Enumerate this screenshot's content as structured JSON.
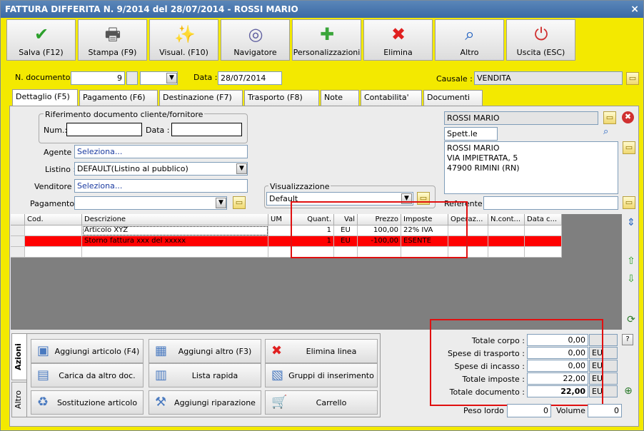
{
  "window": {
    "title": "FATTURA DIFFERITA N. 9/2014 del 28/07/2014 - ROSSI MARIO",
    "close": "×"
  },
  "toolbar": [
    {
      "label": "Salva (F12)",
      "icon": "check-icon",
      "glyph": "✔",
      "color": "#2ca02c"
    },
    {
      "label": "Stampa (F9)",
      "icon": "printer-icon",
      "glyph": "🖶",
      "color": "#555"
    },
    {
      "label": "Visual. (F10)",
      "icon": "magic-wand-icon",
      "glyph": "✨",
      "color": "#333"
    },
    {
      "label": "Navigatore",
      "icon": "compass-icon",
      "glyph": "◎",
      "color": "#6060a0"
    },
    {
      "label": "Personalizzazioni",
      "icon": "puzzle-icon",
      "glyph": "✚",
      "color": "#3aa53a"
    },
    {
      "label": "Elimina",
      "icon": "delete-x-icon",
      "glyph": "✖",
      "color": "#e02020"
    },
    {
      "label": "Altro",
      "icon": "magnifier-icon",
      "glyph": "⌕",
      "color": "#2060c0"
    },
    {
      "label": "Uscita (ESC)",
      "icon": "power-icon",
      "glyph": "⏻",
      "color": "#d03030"
    }
  ],
  "header": {
    "n_doc_label": "N. documento :",
    "n_doc": "9",
    "data_label": "Data :",
    "data": "28/07/2014",
    "causale_label": "Causale :",
    "causale": "VENDITA"
  },
  "tabs": [
    "Dettaglio (F5)",
    "Pagamento (F6)",
    "Destinazione (F7)",
    "Trasporto (F8)",
    "Note",
    "Contabilita'",
    "Documenti"
  ],
  "rif": {
    "title": "Riferimento documento cliente/fornitore",
    "num_label": "Num.:",
    "data_label": "Data :",
    "num": "",
    "data": ""
  },
  "fields": {
    "agente_label": "Agente :",
    "agente": "Seleziona...",
    "listino_label": "Listino :",
    "listino": "DEFAULT(Listino al pubblico)",
    "venditore_label": "Venditore :",
    "venditore": "Seleziona...",
    "pagamento_label": "Pagamento :",
    "pagamento": "",
    "visualizzazione_title": "Visualizzazione",
    "visualizzazione": "Default"
  },
  "cliente": {
    "name": "ROSSI MARIO",
    "spett": "Spett.le",
    "address": [
      "ROSSI MARIO",
      "VIA IMPIETRATA, 5",
      "47900 RIMINI (RN)"
    ],
    "referente_label": "Referente",
    "referente": ""
  },
  "grid": {
    "columns": [
      "Cod.",
      "Descrizione",
      "UM",
      "Quant.",
      "Val",
      "Prezzo",
      "Imposte",
      "Operaz...",
      "N.cont...",
      "Data c..."
    ],
    "rows": [
      {
        "cod": "",
        "descrizione": "Articolo XYZ",
        "um": "",
        "quant": "1",
        "val": "EU",
        "prezzo": "100,00",
        "imposte": "22% IVA",
        "highlight": false
      },
      {
        "cod": "",
        "descrizione": "Storno fattura xxx del xxxxx",
        "um": "",
        "quant": "1",
        "val": "EU",
        "prezzo": "-100,00",
        "imposte": "ESENTE",
        "highlight": true
      }
    ]
  },
  "actions": {
    "tab_azioni": "Azioni",
    "tab_altro": "Altro",
    "buttons": [
      {
        "label": "Aggiungi articolo (F4)",
        "icon": "add-article-icon",
        "glyph": "▣"
      },
      {
        "label": "Aggiungi altro (F3)",
        "icon": "add-other-icon",
        "glyph": "▦"
      },
      {
        "label": "Elimina linea",
        "icon": "delete-line-icon",
        "glyph": "✖"
      },
      {
        "label": "Carica da altro doc.",
        "icon": "load-doc-icon",
        "glyph": "▤"
      },
      {
        "label": "Lista rapida",
        "icon": "quick-list-icon",
        "glyph": "▥"
      },
      {
        "label": "Gruppi di inserimento",
        "icon": "groups-icon",
        "glyph": "▧"
      },
      {
        "label": "Sostituzione articolo",
        "icon": "replace-article-icon",
        "glyph": "♻"
      },
      {
        "label": "Aggiungi riparazione",
        "icon": "wrench-icon",
        "glyph": "⚒"
      },
      {
        "label": "Carrello",
        "icon": "cart-icon",
        "glyph": "🛒"
      }
    ]
  },
  "totals": [
    {
      "label": "Totale corpo :",
      "value": "0,00",
      "cur": ""
    },
    {
      "label": "Spese di trasporto :",
      "value": "0,00",
      "cur": "EU"
    },
    {
      "label": "Spese di incasso :",
      "value": "0,00",
      "cur": "EU"
    },
    {
      "label": "Totale imposte :",
      "value": "22,00",
      "cur": "EU"
    },
    {
      "label": "Totale documento :",
      "value": "22,00",
      "cur": "EU"
    }
  ],
  "peso": {
    "peso_label": "Peso lordo :",
    "peso": "0",
    "volume_label": "Volume :",
    "volume": "0"
  },
  "help": "?",
  "colors": {
    "background": "#f3e900",
    "highlight_row": "#ff0000",
    "annotation": "#e01010"
  }
}
